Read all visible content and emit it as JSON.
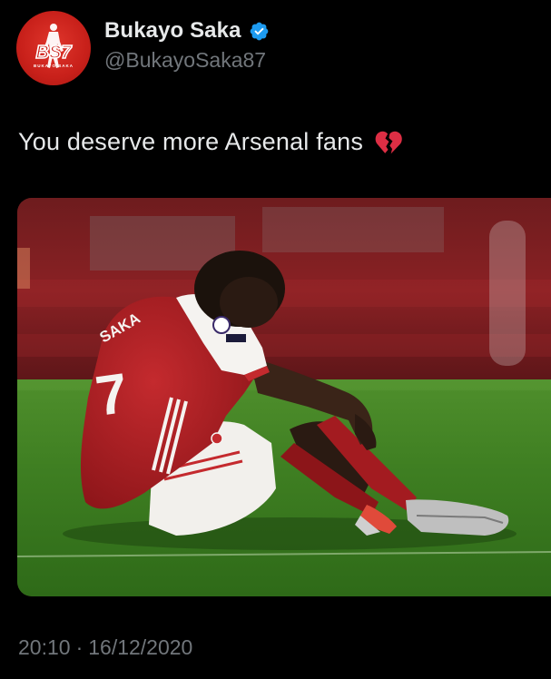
{
  "profile": {
    "display_name": "Bukayo Saka",
    "handle": "@BukayoSaka87",
    "verified": true,
    "avatar_icon": "avatar-logo-bs7-icon",
    "avatar_text": "BS7",
    "avatar_subtext": "BUKAYO SAKA"
  },
  "tweet": {
    "text": "You deserve more Arsenal fans",
    "emoji": "broken-heart-icon",
    "time": "20:10",
    "separator": "·",
    "date": "16/12/2020"
  },
  "media": {
    "description_icon": "photo-player-sitting-on-pitch",
    "shirt_number": "7",
    "shirt_name": "SAKA"
  },
  "colors": {
    "background": "#000000",
    "text_primary": "#e7e9ea",
    "text_secondary": "#71767b",
    "verified_blue": "#1d9bf0",
    "avatar_red": "#c8201a",
    "broken_heart": "#dd2e44"
  }
}
